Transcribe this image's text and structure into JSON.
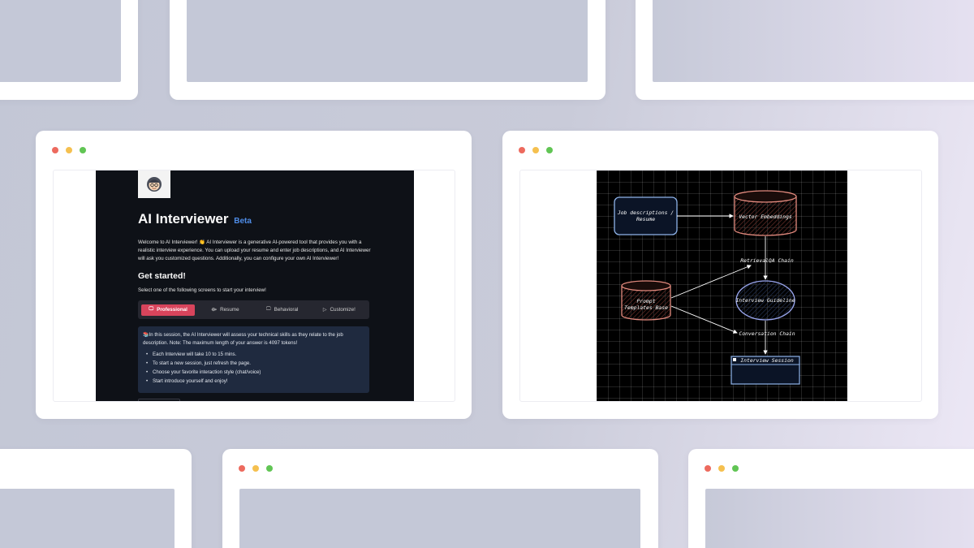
{
  "app": {
    "title": "AI Interviewer",
    "beta": "Beta",
    "intro": "Welcome to AI Interviewer! 👏 AI Interviewer is a generative AI-powered tool that provides you with a realistic interview experience. You can upload your resume and enter job descriptions, and AI Interviewer will ask you customized questions. Additionally, you can configure your own AI Interviewer!",
    "get_started": "Get started!",
    "select_text": "Select one of the following screens to start your interview!",
    "tabs": [
      {
        "label": "Professional",
        "icon": "monitor-icon",
        "glyph": "🖵"
      },
      {
        "label": "Resume",
        "icon": "resume-icon",
        "glyph": "⟴"
      },
      {
        "label": "Behavioral",
        "icon": "monitor-icon",
        "glyph": "🖵"
      },
      {
        "label": "Customize!",
        "icon": "play-icon",
        "glyph": "▷"
      }
    ],
    "info_text": "📚In this session, the AI Interviewer will assess your technical skills as they relate to the job description. Note: The maximum length of your answer is 4097 tokens!",
    "bullets": [
      "Each Interview will take 10 to 15 mins.",
      "To start a new session, just refresh the page.",
      "Choose your favorite interaction style (chat/voice)",
      "Start introduce yourself and enjoy!"
    ]
  },
  "diagram": {
    "nodes": {
      "job": "Job descriptions /\nResume",
      "vector": "Vector Embeddings",
      "prompt": "Prompt\nTemplates Base",
      "guideline": "Interview Guideline",
      "session": "Interview Session"
    },
    "edges": {
      "retrieval": "RetrievalQA Chain",
      "conversation": "Conversation Chain"
    },
    "colors": {
      "job": "#8fb4ea",
      "vector": "#e28a7e",
      "prompt": "#e28a7e",
      "guideline": "#9aa6ee",
      "session": "#8fb4ea"
    }
  }
}
